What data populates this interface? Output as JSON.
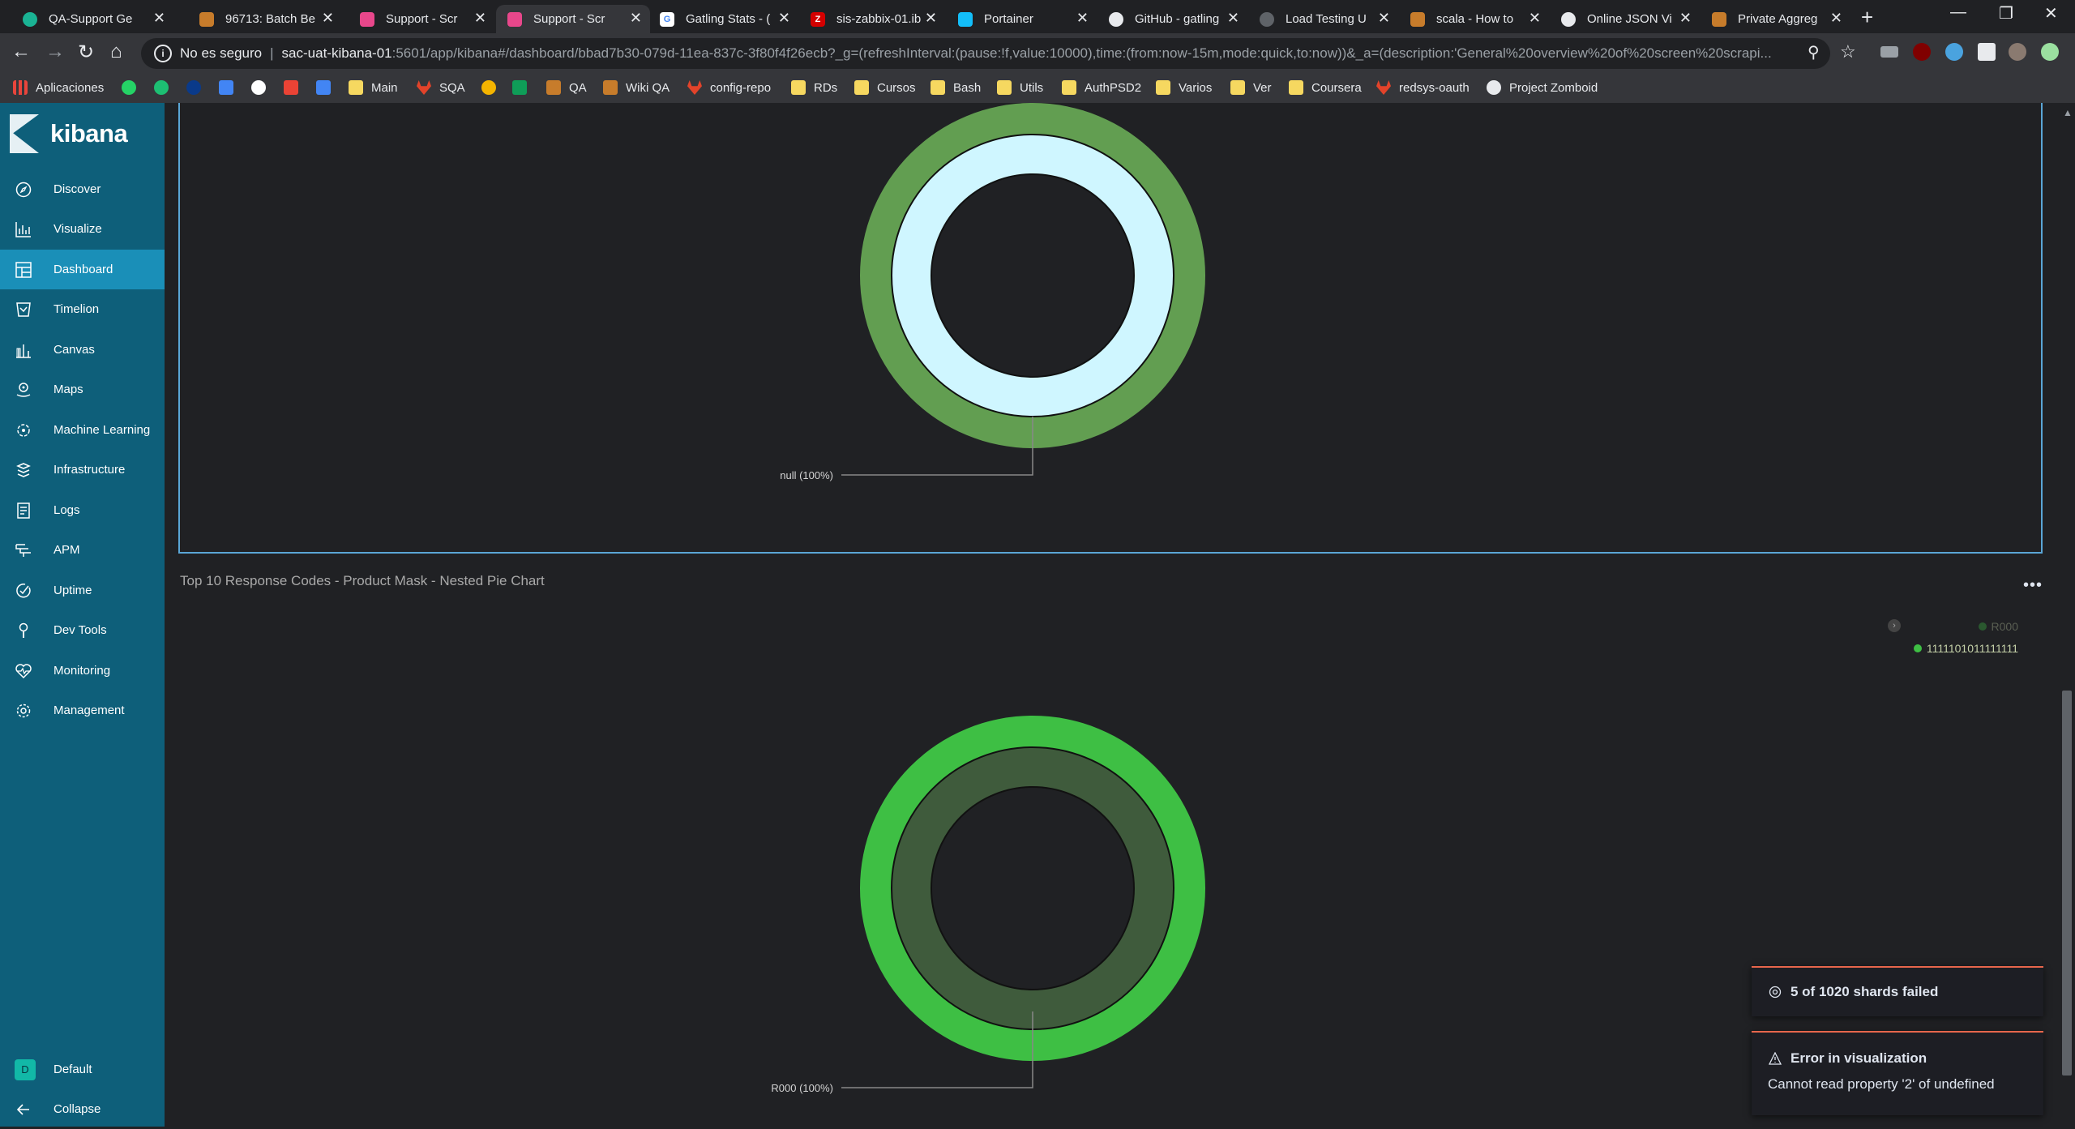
{
  "browser": {
    "tabs": [
      {
        "title": "QA-Support Ge",
        "favicon": "circle-teal-icon"
      },
      {
        "title": "96713: Batch Be",
        "favicon": "jira-icon"
      },
      {
        "title": "Support - Scr",
        "favicon": "kibana-icon"
      },
      {
        "title": "Support - Scr",
        "favicon": "kibana-icon"
      },
      {
        "title": "Gatling Stats - (",
        "favicon": "google-icon"
      },
      {
        "title": "sis-zabbix-01.ib",
        "favicon": "zabbix-icon"
      },
      {
        "title": "Portainer",
        "favicon": "portainer-icon"
      },
      {
        "title": "GitHub - gatling",
        "favicon": "github-icon"
      },
      {
        "title": "Load Testing U",
        "favicon": "globe-icon"
      },
      {
        "title": "scala - How to",
        "favicon": "jira-icon"
      },
      {
        "title": "Online JSON Vi",
        "favicon": "globe-icon"
      },
      {
        "title": "Private Aggreg",
        "favicon": "jira-icon"
      }
    ],
    "insecure_label": "No es seguro",
    "url_host": "sac-uat-kibana-01",
    "url_path": ":5601/app/kibana#/dashboard/bbad7b30-079d-11ea-837c-3f80f4f26ecb?_g=(refreshInterval:(pause:!f,value:10000),time:(from:now-15m,mode:quick,to:now))&_a=(description:'General%20overview%20of%20screen%20scrapi...",
    "bookmarks": [
      {
        "label": "Aplicaciones",
        "icon": "apps-grid-icon"
      },
      {
        "label": "Main",
        "icon": "folder-icon"
      },
      {
        "label": "SQA",
        "icon": "gitlab-icon"
      },
      {
        "label": "QA",
        "icon": "jira-icon"
      },
      {
        "label": "Wiki QA",
        "icon": "jira-icon"
      },
      {
        "label": "config-repo",
        "icon": "gitlab-icon"
      },
      {
        "label": "RDs",
        "icon": "folder-icon"
      },
      {
        "label": "Cursos",
        "icon": "folder-icon"
      },
      {
        "label": "Bash",
        "icon": "folder-icon"
      },
      {
        "label": "Utils",
        "icon": "folder-icon"
      },
      {
        "label": "AuthPSD2",
        "icon": "folder-icon"
      },
      {
        "label": "Varios",
        "icon": "folder-icon"
      },
      {
        "label": "Ver",
        "icon": "folder-icon"
      },
      {
        "label": "Coursera",
        "icon": "folder-icon"
      },
      {
        "label": "redsys-oauth",
        "icon": "gitlab-icon"
      },
      {
        "label": "Project Zomboid",
        "icon": "steam-icon"
      }
    ]
  },
  "kibana": {
    "logo_text": "kibana",
    "nav": [
      {
        "label": "Discover",
        "icon": "compass-icon"
      },
      {
        "label": "Visualize",
        "icon": "chart-icon"
      },
      {
        "label": "Dashboard",
        "icon": "dashboard-icon",
        "active": true
      },
      {
        "label": "Timelion",
        "icon": "timelion-icon"
      },
      {
        "label": "Canvas",
        "icon": "canvas-icon"
      },
      {
        "label": "Maps",
        "icon": "maps-icon"
      },
      {
        "label": "Machine Learning",
        "icon": "ml-icon"
      },
      {
        "label": "Infrastructure",
        "icon": "infrastructure-icon"
      },
      {
        "label": "Logs",
        "icon": "logs-icon"
      },
      {
        "label": "APM",
        "icon": "apm-icon"
      },
      {
        "label": "Uptime",
        "icon": "uptime-icon"
      },
      {
        "label": "Dev Tools",
        "icon": "wrench-icon"
      },
      {
        "label": "Monitoring",
        "icon": "monitoring-icon"
      },
      {
        "label": "Management",
        "icon": "gear-icon"
      }
    ],
    "space_badge": "D",
    "space_label": "Default",
    "collapse_label": "Collapse"
  },
  "panels": {
    "panel1": {
      "slice_label": "null (100%)",
      "colors": {
        "outer": "#629e51",
        "inner": "#cff6ff"
      }
    },
    "panel2": {
      "title": "Top 10 Response Codes - Product Mask - Nested Pie Chart",
      "slice_label": "R000 (100%)",
      "legend": [
        {
          "label": "R000",
          "color": "#3ebf44",
          "faded": true
        },
        {
          "label": "1111101011111111",
          "color": "#3ebf44",
          "faded": false
        }
      ],
      "colors": {
        "outer": "#3ebf44",
        "inner": "#3f5b3c"
      }
    }
  },
  "toasts": [
    {
      "title": "5 of 1020 shards failed",
      "icon": "alert-icon"
    },
    {
      "title": "Error in visualization",
      "body": "Cannot read property '2' of undefined",
      "icon": "warning-icon"
    }
  ]
}
